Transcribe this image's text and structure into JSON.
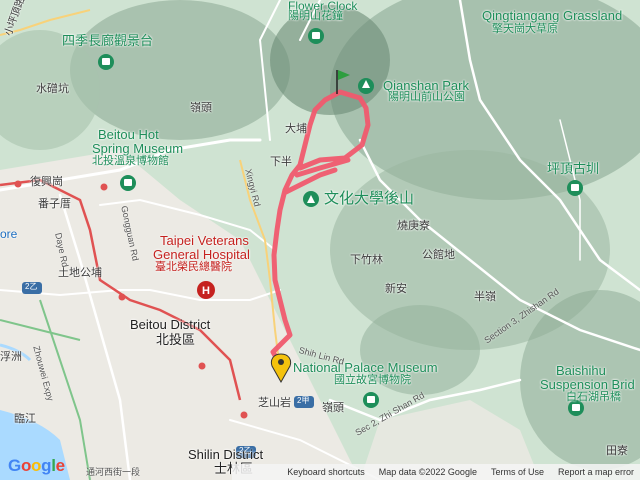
{
  "map": {
    "pois": {
      "flower_clock": {
        "en": "Flower Clock",
        "zh": "陽明山花鐘"
      },
      "qingtiangang": {
        "en": "Qingtiangang Grassland",
        "zh": "擎天崗大草原"
      },
      "sijichang": {
        "zh": "四季長廊觀景台"
      },
      "qianshan": {
        "en": "Qianshan Park",
        "zh": "陽明山前山公園"
      },
      "beitou_museum": {
        "en1": "Beitou Hot",
        "en2": "Spring Museum",
        "zh": "北投溫泉博物館"
      },
      "culture_univ": {
        "zh": "文化大學後山"
      },
      "pingding": {
        "zh": "坪頂古圳"
      },
      "veterans": {
        "en1": "Taipei Veterans",
        "en2": "General Hospital",
        "zh": "臺北榮民總醫院"
      },
      "palace_museum": {
        "en": "National Palace Museum",
        "zh": "國立故宮博物院"
      },
      "baishihu": {
        "en1": "Baishihu",
        "en2": "Suspension Brid",
        "zh": "白石湖吊橋"
      }
    },
    "places": {
      "xiaokeng": "小坪頂路",
      "shuiliang": "水磳坑",
      "lingtou1": "嶺頭",
      "dapu": "大埔",
      "xiaping": "下半",
      "fuxinggang": "復興崗",
      "jiaziliao": "番子厝",
      "shaogengliao": "燒庚寮",
      "xiazhulin": "下竹林",
      "gongsidi": "公館地",
      "xinan": "新安",
      "banling": "半嶺",
      "tudigong": "土地公埔",
      "fuzhou": "浮洲",
      "linjiang": "臨江",
      "zhishanyan": "芝山岩",
      "lingtou2": "嶺頭",
      "tianliao": "田寮",
      "ore": "ore"
    },
    "districts": {
      "beitou_en": "Beitou District",
      "beitou_zh": "北投區",
      "shilin_en": "Shilin District",
      "shilin_zh": "士林區"
    },
    "roads": {
      "daye": "Daye Rd",
      "gongguan": "Gongguan Rd",
      "xinyi": "Xingyi Rd",
      "zhuowei": "Zhouwei Expy",
      "shilin": "Shih Lin Rd",
      "zhishan": "Sec 2, Zhi Shan Rd",
      "section3": "Section 3, Zhishan Rd",
      "tongheu": "通河西街一段",
      "badge1": "2乙",
      "badge2": "2甲",
      "badge3": "2乙"
    },
    "route_color": "#f05a6e",
    "pin_color": "#f4c20d",
    "flag_color": "#2e9e3f",
    "water_color": "#aadaff",
    "rail_color": "#e05252"
  },
  "footer": {
    "logo": [
      "G",
      "o",
      "o",
      "g",
      "l",
      "e"
    ],
    "shortcuts": "Keyboard shortcuts",
    "mapdata": "Map data ©2022 Google",
    "terms": "Terms of Use",
    "report": "Report a map error"
  }
}
